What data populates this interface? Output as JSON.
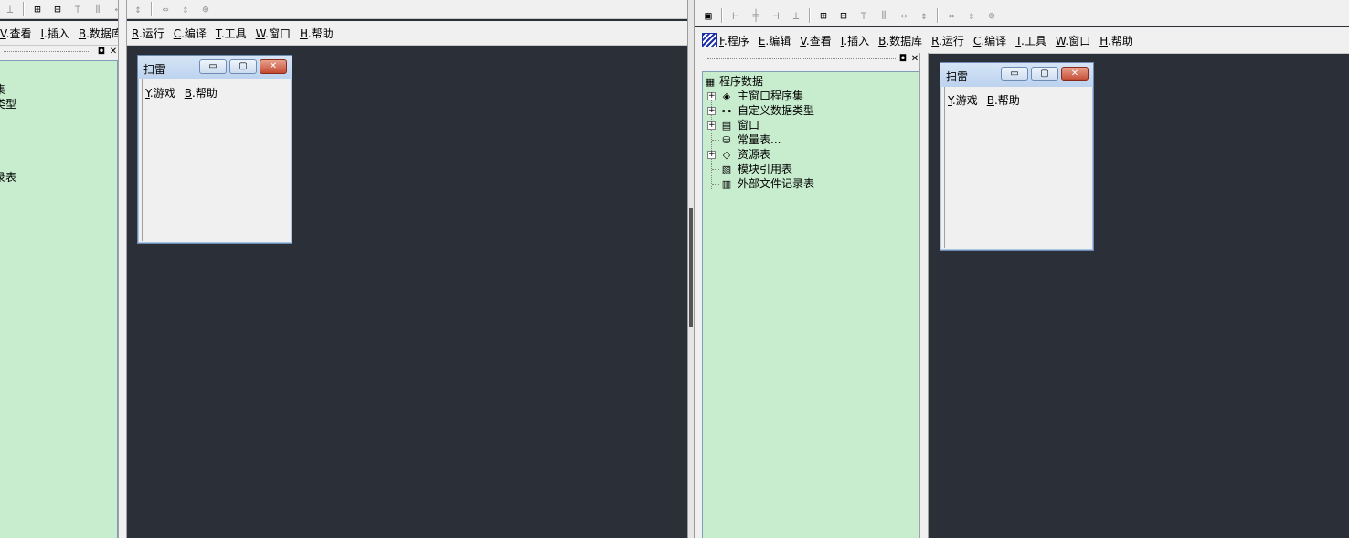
{
  "left_ide": {
    "toolbar_icons": [
      "align-bottom-icon",
      "align-center-both-icon",
      "align-middle-icon",
      "align-top-icon",
      "distribute-horizontal-icon",
      "space-horizontal-icon",
      "space-vertical-icon",
      "same-width-icon",
      "same-height-icon",
      "same-size-icon"
    ],
    "menu": [
      {
        "key": "V",
        "label": ".查看"
      },
      {
        "key": "I",
        "label": ".插入"
      },
      {
        "key": "B",
        "label": ".数据库"
      },
      {
        "key": "R",
        "label": ".运行"
      },
      {
        "key": "C",
        "label": ".编译"
      },
      {
        "key": "T",
        "label": ".工具"
      },
      {
        "key": "W",
        "label": ".窗口"
      },
      {
        "key": "H",
        "label": ".帮助"
      }
    ],
    "tree_partial": [
      "集",
      "类型",
      "录表"
    ],
    "form": {
      "title": "扫雷",
      "menu": [
        {
          "key": "Y",
          "label": ".游戏"
        },
        {
          "key": "B",
          "label": ".帮助"
        }
      ]
    }
  },
  "right_ide": {
    "toolbar_icons": [
      "form-icon",
      "align-left-icon",
      "align-center-icon",
      "align-right-icon",
      "align-bottom-icon",
      "align-center-both-icon",
      "align-middle-icon",
      "align-top-icon",
      "distribute-horizontal-icon",
      "space-horizontal-icon",
      "space-vertical-icon",
      "same-width-icon",
      "same-height-icon",
      "same-size-icon"
    ],
    "menu": [
      {
        "key": "F",
        "label": ".程序"
      },
      {
        "key": "E",
        "label": ".编辑"
      },
      {
        "key": "V",
        "label": ".查看"
      },
      {
        "key": "I",
        "label": ".插入"
      },
      {
        "key": "B",
        "label": ".数据库"
      },
      {
        "key": "R",
        "label": ".运行"
      },
      {
        "key": "C",
        "label": ".编译"
      },
      {
        "key": "T",
        "label": ".工具"
      },
      {
        "key": "W",
        "label": ".窗口"
      },
      {
        "key": "H",
        "label": ".帮助"
      }
    ],
    "tree": {
      "root": "程序数据",
      "items": [
        {
          "label": "主窗口程序集",
          "icon": "layers-icon",
          "expandable": true
        },
        {
          "label": "自定义数据类型",
          "icon": "data-type-icon",
          "expandable": true
        },
        {
          "label": "窗口",
          "icon": "window-icon",
          "expandable": true
        },
        {
          "label": "常量表...",
          "icon": "database-icon",
          "expandable": false
        },
        {
          "label": "资源表",
          "icon": "resource-icon",
          "expandable": true
        },
        {
          "label": "模块引用表",
          "icon": "module-icon",
          "expandable": false
        },
        {
          "label": "外部文件记录表",
          "icon": "file-record-icon",
          "expandable": false
        }
      ]
    },
    "form": {
      "title": "扫雷",
      "menu": [
        {
          "key": "Y",
          "label": ".游戏"
        },
        {
          "key": "B",
          "label": ".帮助"
        }
      ]
    }
  },
  "colors": {
    "workspace": "#2b2f38",
    "tree_background": "#c8ecce",
    "chrome": "#f0f0f0",
    "close_button": "#c44a32"
  }
}
